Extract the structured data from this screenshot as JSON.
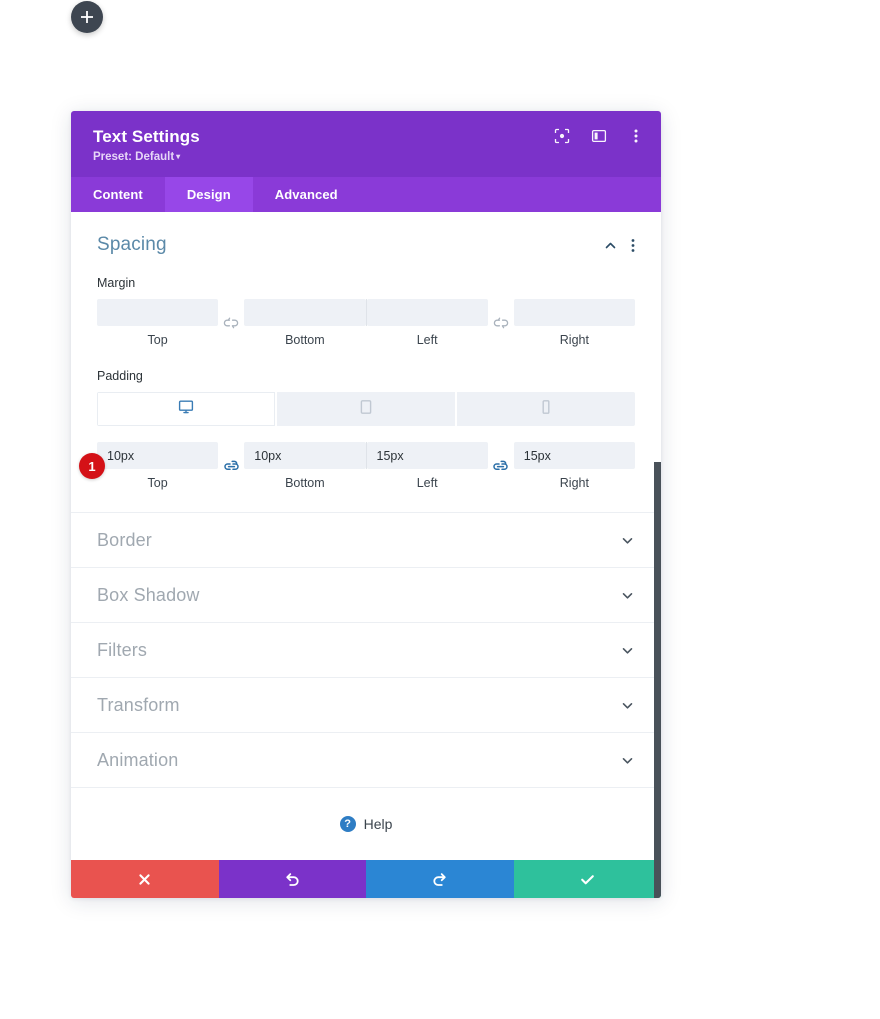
{
  "canvas": {
    "add_button_icon": "plus-icon"
  },
  "modal": {
    "title": "Text Settings",
    "preset_label": "Preset: Default",
    "preset_caret": "▾",
    "header_icons": [
      {
        "name": "focus-mode-icon"
      },
      {
        "name": "split-panel-icon"
      },
      {
        "name": "more-options-icon"
      }
    ],
    "tabs": [
      {
        "label": "Content",
        "active": false
      },
      {
        "label": "Design",
        "active": true
      },
      {
        "label": "Advanced",
        "active": false
      }
    ],
    "spacing": {
      "title": "Spacing",
      "collapse_icon": "chevron-up-icon",
      "options_icon": "more-options-icon",
      "margin": {
        "label": "Margin",
        "link_state": "unlinked",
        "fields": [
          {
            "caption": "Top",
            "value": "",
            "placeholder": ""
          },
          {
            "caption": "Bottom",
            "value": "",
            "placeholder": ""
          },
          {
            "caption": "Left",
            "value": "",
            "placeholder": ""
          },
          {
            "caption": "Right",
            "value": "",
            "placeholder": ""
          }
        ]
      },
      "padding": {
        "label": "Padding",
        "link_state": "linked",
        "badge": "1",
        "devices": [
          {
            "name": "desktop-icon",
            "active": true
          },
          {
            "name": "tablet-icon",
            "active": false
          },
          {
            "name": "phone-icon",
            "active": false
          }
        ],
        "fields": [
          {
            "caption": "Top",
            "value": "10px",
            "placeholder": ""
          },
          {
            "caption": "Bottom",
            "value": "10px",
            "placeholder": ""
          },
          {
            "caption": "Left",
            "value": "15px",
            "placeholder": ""
          },
          {
            "caption": "Right",
            "value": "15px",
            "placeholder": ""
          }
        ]
      }
    },
    "accordions": [
      {
        "label": "Border"
      },
      {
        "label": "Box Shadow"
      },
      {
        "label": "Filters"
      },
      {
        "label": "Transform"
      },
      {
        "label": "Animation"
      }
    ],
    "help": {
      "icon": "question-mark-icon",
      "label": "Help"
    },
    "footer_buttons": [
      {
        "name": "cancel-button",
        "icon": "close-icon",
        "color": "#e9534f"
      },
      {
        "name": "undo-button",
        "icon": "undo-icon",
        "color": "#7b32c9"
      },
      {
        "name": "redo-button",
        "icon": "redo-icon",
        "color": "#2b86d4"
      },
      {
        "name": "save-button",
        "icon": "check-icon",
        "color": "#2ec19c"
      }
    ]
  },
  "colors": {
    "header_purple": "#7b32c9",
    "tab_bar_purple": "#8a3ad8",
    "tab_active_purple": "#9747e8",
    "section_title_blue": "#5b89a8",
    "link_active_blue": "#2b6fa8",
    "badge_red": "#d41117"
  }
}
